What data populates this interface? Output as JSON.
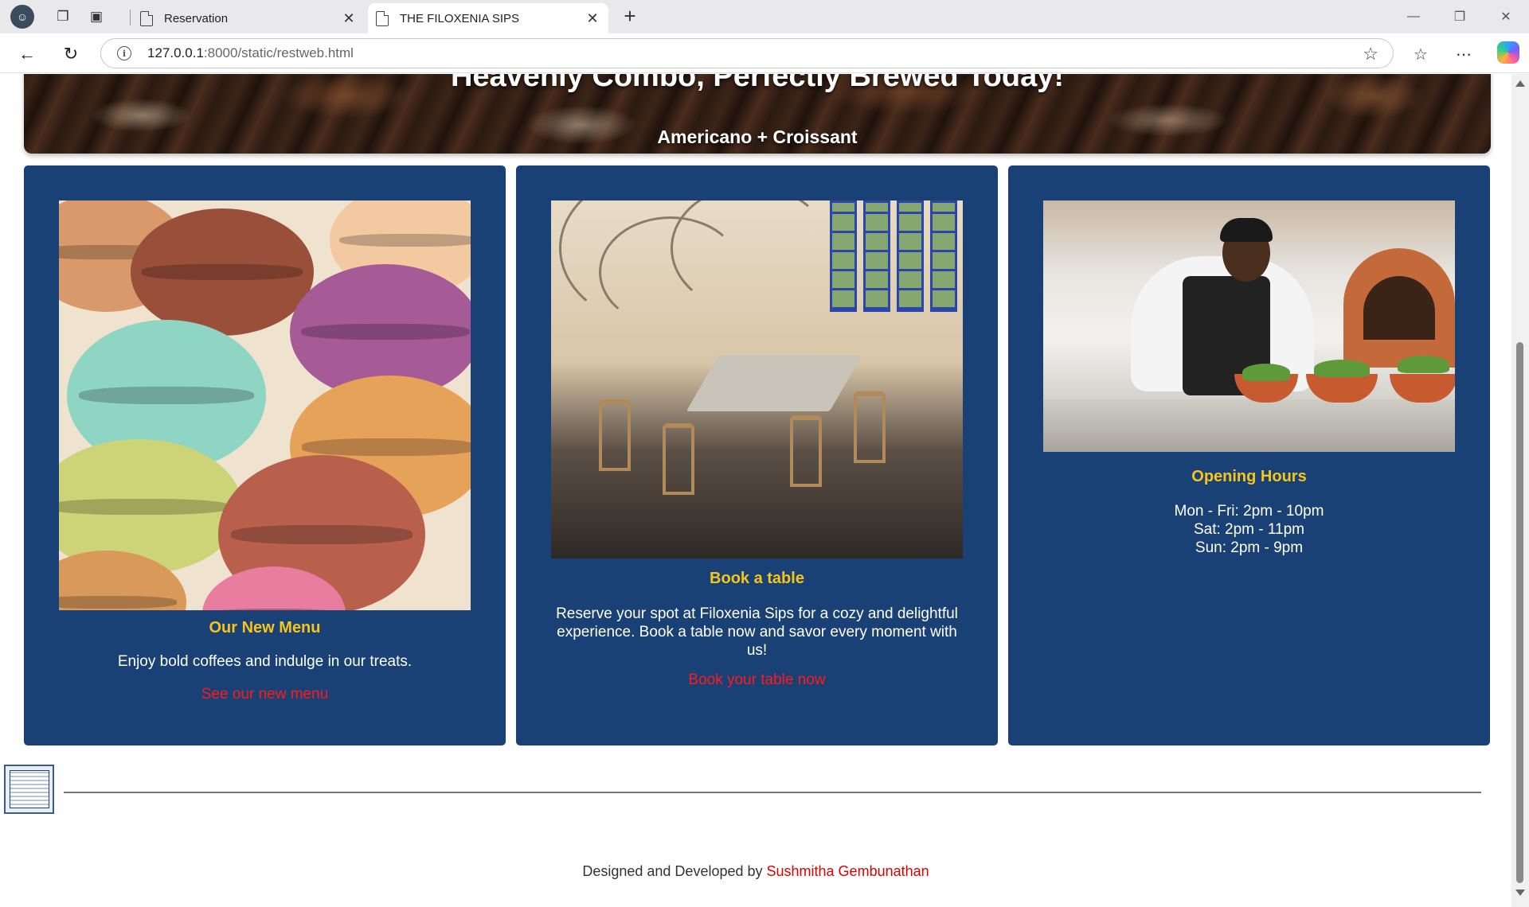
{
  "browser": {
    "tabs": [
      {
        "title": "Reservation",
        "active": false
      },
      {
        "title": "THE FILOXENIA SIPS",
        "active": true
      }
    ],
    "url_host": "127.0.0.1",
    "url_rest": ":8000/static/restweb.html"
  },
  "hero": {
    "title": "Heavenly Combo, Perfectly Brewed Today!",
    "subtitle": "Americano + Croissant"
  },
  "cards": [
    {
      "title": "Our New Menu",
      "text": "Enjoy bold coffees and indulge in our treats.",
      "link": "See our new menu",
      "image": "macarons-photo"
    },
    {
      "title": "Book a table",
      "text": "Reserve your spot at Filoxenia Sips for a cozy and delightful experience. Book a table now and savor every moment with us!",
      "link": "Book your table now",
      "image": "restaurant-interior-photo"
    },
    {
      "title": "Opening Hours",
      "hours": [
        "Mon - Fri: 2pm - 10pm",
        "Sat: 2pm - 11pm",
        "Sun: 2pm - 9pm"
      ],
      "image": "chef-plating-photo"
    }
  ],
  "footer": {
    "prefix": "Designed and Developed by ",
    "author": "Sushmitha Gembunathan"
  },
  "colors": {
    "card_bg": "#1a4175",
    "heading": "#f5c518",
    "link": "#ff1a1a"
  }
}
